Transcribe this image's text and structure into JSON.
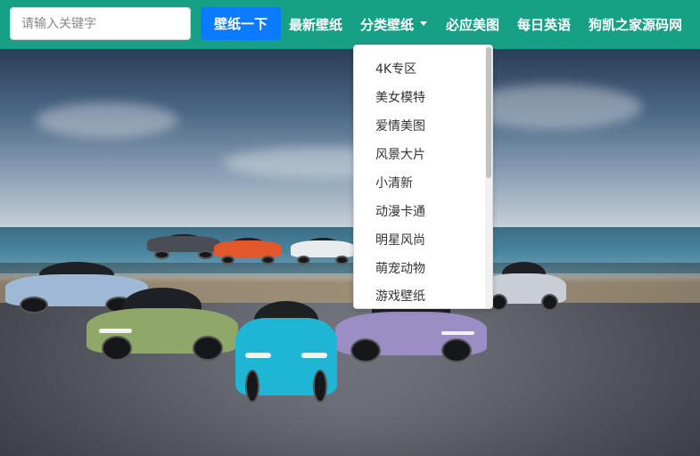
{
  "search": {
    "placeholder": "请输入关键字",
    "value": "",
    "button_label": "壁纸一下"
  },
  "nav": {
    "items": [
      {
        "label": "最新壁纸"
      },
      {
        "label": "分类壁纸",
        "has_caret": true
      },
      {
        "label": "必应美图"
      },
      {
        "label": "每日英语"
      },
      {
        "label": "狗凯之家源码网"
      }
    ]
  },
  "dropdown": {
    "items": [
      {
        "label": "4K专区"
      },
      {
        "label": "美女模特"
      },
      {
        "label": "爱情美图"
      },
      {
        "label": "风景大片"
      },
      {
        "label": "小清新"
      },
      {
        "label": "动漫卡通"
      },
      {
        "label": "明星风尚"
      },
      {
        "label": "萌宠动物"
      },
      {
        "label": "游戏壁纸"
      }
    ]
  },
  "colors": {
    "navbar": "#16a085",
    "search_button": "#0d7bff"
  }
}
